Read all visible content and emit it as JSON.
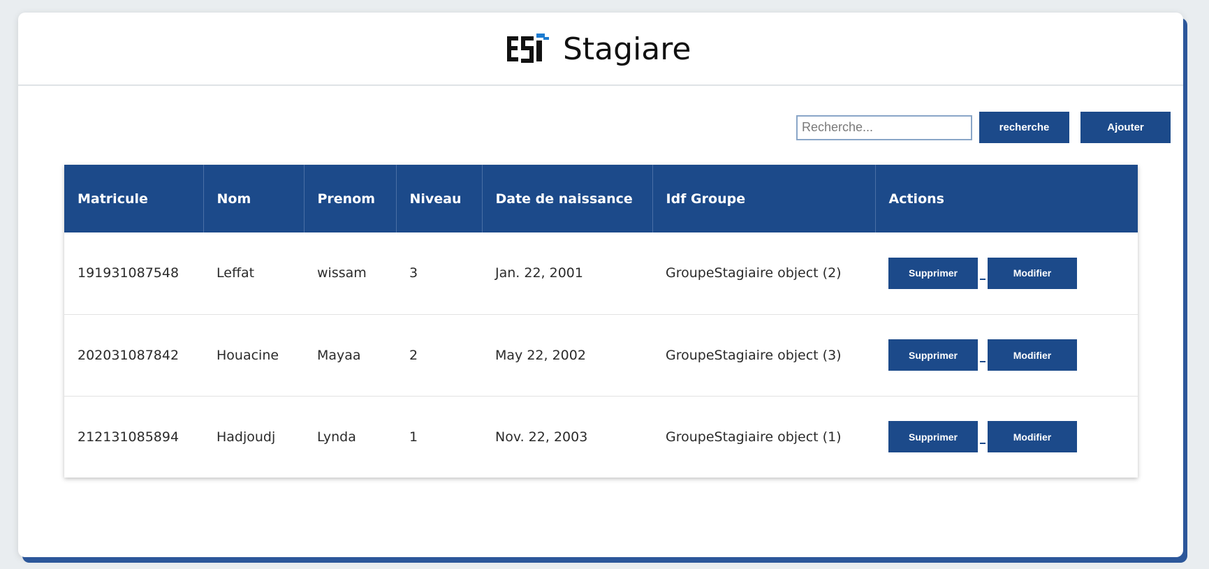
{
  "header": {
    "title": "Stagiare",
    "logo_text": "ESI",
    "accent_color": "#1c4a8a"
  },
  "toolbar": {
    "search_placeholder": "Recherche...",
    "search_value": "",
    "search_button": "recherche",
    "add_button": "Ajouter"
  },
  "table": {
    "columns": [
      "Matricule",
      "Nom",
      "Prenom",
      "Niveau",
      "Date de naissance",
      "Idf Groupe",
      "Actions"
    ],
    "rows": [
      {
        "matricule": "191931087548",
        "nom": "Leffat",
        "prenom": "wissam",
        "niveau": "3",
        "date_naissance": "Jan. 22, 2001",
        "groupe": "GroupeStagiaire object (2)",
        "delete_label": "Supprimer",
        "edit_label": "Modifier"
      },
      {
        "matricule": "202031087842",
        "nom": "Houacine",
        "prenom": "Mayaa",
        "niveau": "2",
        "date_naissance": "May 22, 2002",
        "groupe": "GroupeStagiaire object (3)",
        "delete_label": "Supprimer",
        "edit_label": "Modifier"
      },
      {
        "matricule": "212131085894",
        "nom": "Hadjoudj",
        "prenom": "Lynda",
        "niveau": "1",
        "date_naissance": "Nov. 22, 2003",
        "groupe": "GroupeStagiaire object (1)",
        "delete_label": "Supprimer",
        "edit_label": "Modifier"
      }
    ]
  }
}
